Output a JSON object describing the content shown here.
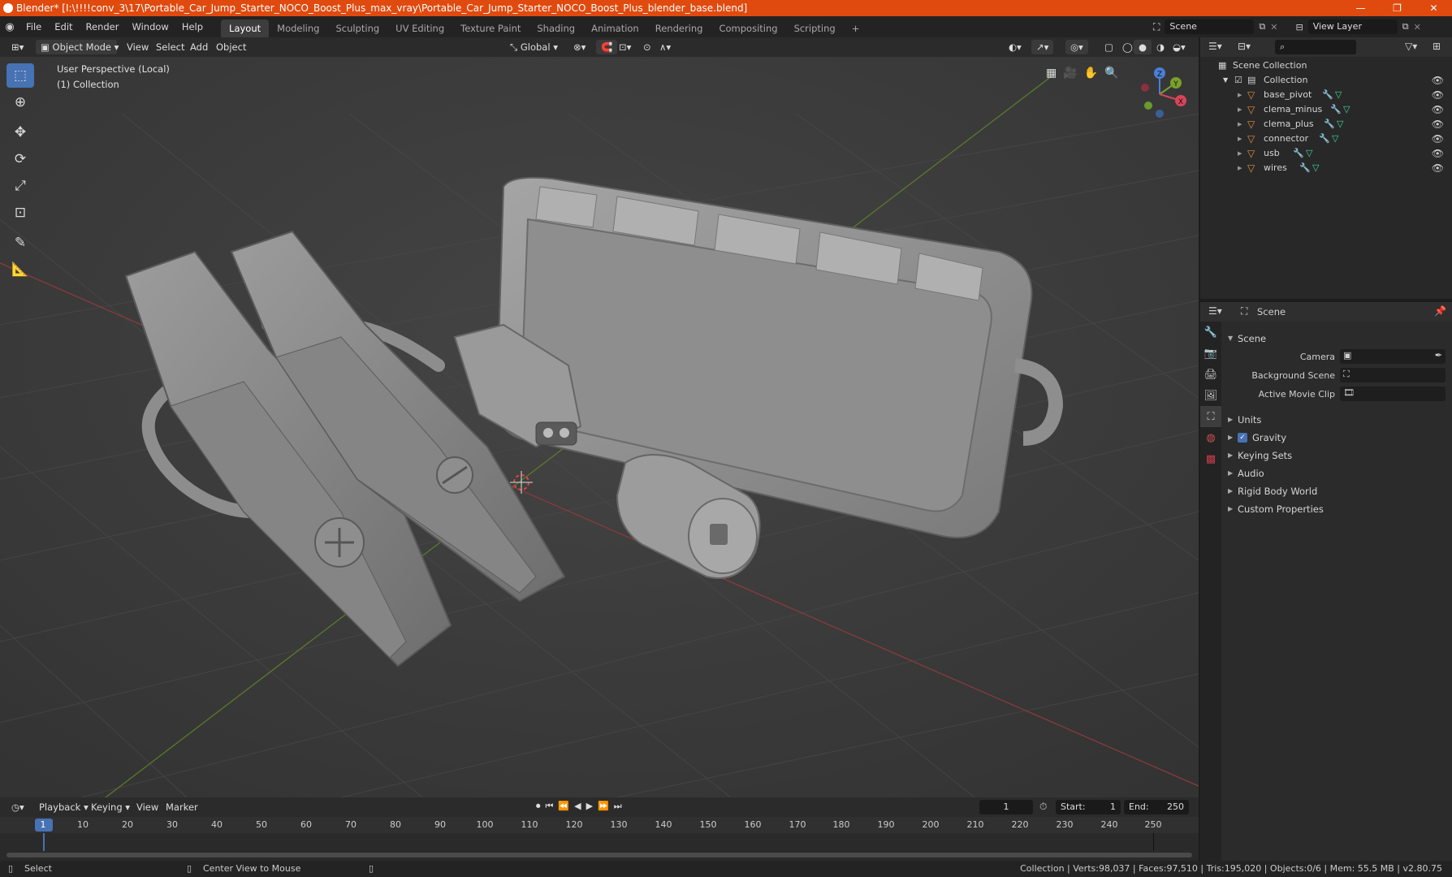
{
  "window": {
    "title": "Blender* [I:\\!!!!conv_3\\17\\Portable_Car_Jump_Starter_NOCO_Boost_Plus_max_vray\\Portable_Car_Jump_Starter_NOCO_Boost_Plus_blender_base.blend]",
    "min_glyph": "—",
    "restore_glyph": "❐",
    "close_glyph": "✕"
  },
  "menu": [
    "File",
    "Edit",
    "Render",
    "Window",
    "Help"
  ],
  "workspaces": [
    "Layout",
    "Modeling",
    "Sculpting",
    "UV Editing",
    "Texture Paint",
    "Shading",
    "Animation",
    "Rendering",
    "Compositing",
    "Scripting"
  ],
  "workspace_add": "+",
  "scene": {
    "label": "Scene",
    "view_layer": "View Layer"
  },
  "viewport_header": {
    "mode": "Object Mode",
    "menus": [
      "View",
      "Select",
      "Add",
      "Object"
    ],
    "orientation": "Global"
  },
  "viewport": {
    "perspective": "User Perspective (Local)",
    "collection": "(1) Collection",
    "gizmo": {
      "x": "X",
      "y": "Y",
      "z": "Z"
    }
  },
  "outliner": {
    "root": "Scene Collection",
    "collection": "Collection",
    "objects": [
      "base_pivot",
      "clema_minus",
      "clema_plus",
      "connector",
      "usb",
      "wires"
    ]
  },
  "properties": {
    "header": "Scene",
    "panel": "Scene",
    "camera_label": "Camera",
    "background_label": "Background Scene",
    "clip_label": "Active Movie Clip",
    "sections": [
      "Units",
      "Gravity",
      "Keying Sets",
      "Audio",
      "Rigid Body World",
      "Custom Properties"
    ]
  },
  "timeline": {
    "menus": [
      "Playback",
      "Keying",
      "View",
      "Marker"
    ],
    "current_frame": "1",
    "start_label": "Start:",
    "start": "1",
    "end_label": "End:",
    "end": "250",
    "ticks": [
      "1",
      "10",
      "20",
      "30",
      "40",
      "50",
      "60",
      "70",
      "80",
      "90",
      "100",
      "110",
      "120",
      "130",
      "140",
      "150",
      "160",
      "170",
      "180",
      "190",
      "200",
      "210",
      "220",
      "230",
      "240",
      "250"
    ]
  },
  "statusbar": {
    "select": "Select",
    "center": "Center View to Mouse",
    "stats": "Collection | Verts:98,037 | Faces:97,510 | Tris:195,020 | Objects:0/6 | Mem: 55.5 MB | v2.80.75"
  },
  "colors": {
    "accent": "#4772b3",
    "titlebar": "#e04a0f",
    "object_icon": "#e8913a",
    "mesh_icon": "#3fd6a3"
  }
}
